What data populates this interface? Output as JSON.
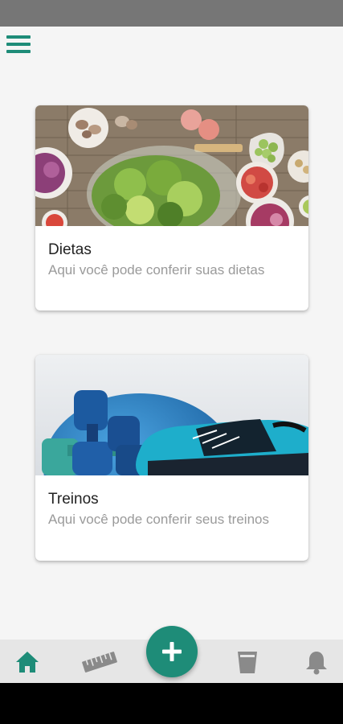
{
  "colors": {
    "accent": "#1e8c78",
    "status_bar": "#767676",
    "nav_bg": "#e6e6e6",
    "nav_icon_inactive": "#8a8a8a"
  },
  "menu": {
    "icon": "hamburger-menu-icon"
  },
  "cards": [
    {
      "title": "Dietas",
      "subtitle": "Aqui você pode conferir suas dietas",
      "image": "food-bowls-salad-photo"
    },
    {
      "title": "Treinos",
      "subtitle": "Aqui você pode conferir seus treinos",
      "image": "dumbbells-sneaker-ball-photo"
    }
  ],
  "bottom_nav": {
    "items": [
      {
        "icon": "home-icon",
        "active": true
      },
      {
        "icon": "ruler-icon",
        "active": false
      },
      {
        "icon": "add-icon",
        "active": false
      },
      {
        "icon": "cup-icon",
        "active": false
      },
      {
        "icon": "bell-icon",
        "active": false
      }
    ]
  }
}
